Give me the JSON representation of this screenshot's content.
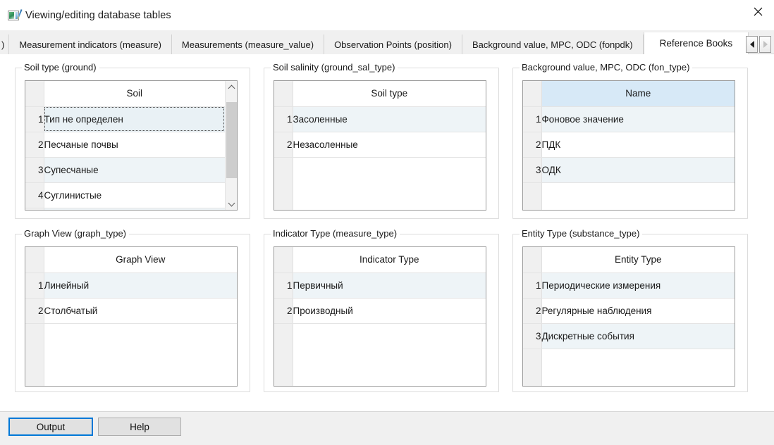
{
  "window": {
    "title": "Viewing/editing database tables",
    "icon": "database-table-edit-icon",
    "close_label": "✕"
  },
  "tabs": {
    "items": [
      {
        "label": ")",
        "active": false,
        "partial": true
      },
      {
        "label": "Measurement indicators (measure)",
        "active": false
      },
      {
        "label": "Measurements (measure_value)",
        "active": false
      },
      {
        "label": "Observation Points (position)",
        "active": false
      },
      {
        "label": "Background value, MPC, ODC (fonpdk)",
        "active": false
      },
      {
        "label": "Reference Books",
        "active": true
      }
    ],
    "scroll_left_label": "◀",
    "scroll_right_label": "▶"
  },
  "panels": [
    {
      "id": "ground",
      "title": "Soil type (ground)",
      "column_header": "Soil",
      "header_focused": false,
      "scrollbar": true,
      "rows": [
        {
          "num": "1",
          "value": "Тип не определен",
          "selected": true
        },
        {
          "num": "2",
          "value": "Песчаные почвы",
          "selected": false
        },
        {
          "num": "3",
          "value": "Супесчаные",
          "selected": false
        },
        {
          "num": "4",
          "value": "Суглинистые",
          "selected": false
        },
        {
          "num": "",
          "value": "",
          "selected": false
        }
      ],
      "filler_rows": 0
    },
    {
      "id": "ground_sal_type",
      "title": "Soil salinity (ground_sal_type)",
      "column_header": "Soil type",
      "header_focused": false,
      "scrollbar": false,
      "rows": [
        {
          "num": "1",
          "value": "Засоленные",
          "selected": false
        },
        {
          "num": "2",
          "value": "Незасоленные",
          "selected": false
        }
      ],
      "filler_rows": 1
    },
    {
      "id": "fon_type",
      "title": "Background value, MPC, ODC (fon_type)",
      "column_header": "Name",
      "header_focused": true,
      "scrollbar": false,
      "rows": [
        {
          "num": "1",
          "value": "Фоновое значение",
          "selected": false
        },
        {
          "num": "2",
          "value": "ПДК",
          "selected": false
        },
        {
          "num": "3",
          "value": "ОДК",
          "selected": false
        }
      ],
      "filler_rows": 1
    },
    {
      "id": "graph_type",
      "title": "Graph View (graph_type)",
      "column_header": "Graph View",
      "header_focused": false,
      "scrollbar": false,
      "rows": [
        {
          "num": "1",
          "value": "Линейный",
          "selected": false
        },
        {
          "num": "2",
          "value": "Столбчатый",
          "selected": false
        }
      ],
      "filler_rows": 1
    },
    {
      "id": "measure_type",
      "title": "Indicator Type (measure_type)",
      "column_header": "Indicator Type",
      "header_focused": false,
      "scrollbar": false,
      "rows": [
        {
          "num": "1",
          "value": "Первичный",
          "selected": false
        },
        {
          "num": "2",
          "value": "Производный",
          "selected": false
        }
      ],
      "filler_rows": 1
    },
    {
      "id": "substance_type",
      "title": "Entity Type (substance_type)",
      "column_header": "Entity Type",
      "header_focused": false,
      "scrollbar": false,
      "rows": [
        {
          "num": "1",
          "value": "Периодические измерения",
          "selected": false
        },
        {
          "num": "2",
          "value": "Регулярные наблюдения",
          "selected": false
        },
        {
          "num": "3",
          "value": "Дискретные события",
          "selected": false
        }
      ],
      "filler_rows": 1
    }
  ],
  "buttons": {
    "output_label": "Output",
    "help_label": "Help"
  },
  "colors": {
    "accent": "#0078d7",
    "header_focus_bg": "#d7e9f7",
    "row_alt_bg": "#eef4f7",
    "window_bg": "#f0f0f0",
    "panel_bg": "#ffffff"
  }
}
